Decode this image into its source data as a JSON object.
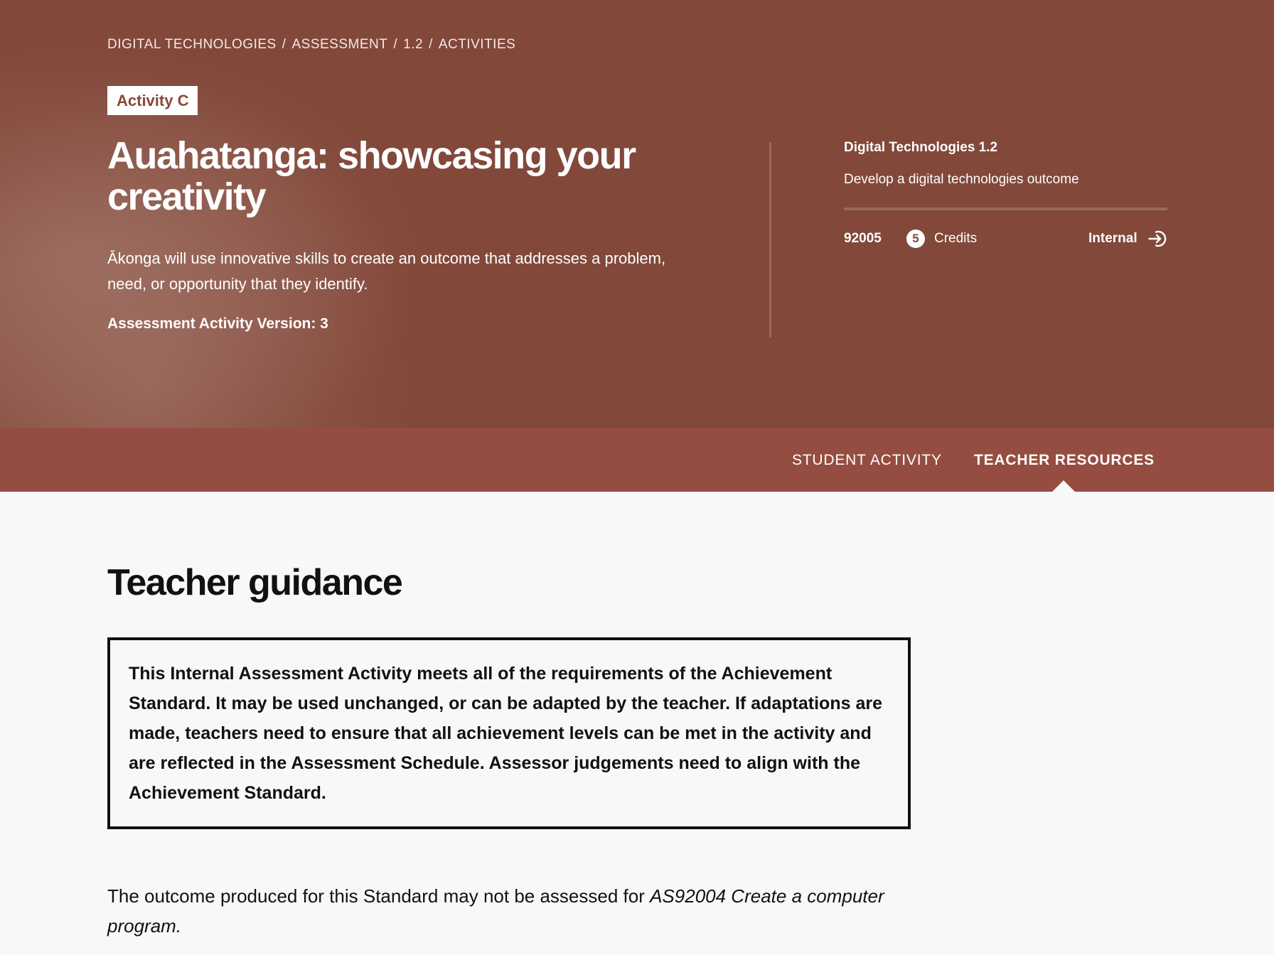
{
  "breadcrumb": {
    "items": [
      "DIGITAL TECHNOLOGIES",
      "ASSESSMENT",
      "1.2",
      "ACTIVITIES"
    ],
    "separator": "/"
  },
  "hero": {
    "badge": "Activity C",
    "title": "Auahatanga: showcasing your creativity",
    "description": "Ākonga will use innovative skills to create an outcome that addresses a problem, need, or opportunity that they identify.",
    "version": "Assessment Activity Version: 3"
  },
  "standard": {
    "title": "Digital Technologies 1.2",
    "description": "Develop a digital technologies outcome",
    "number": "92005",
    "credits": "5",
    "credits_label": "Credits",
    "assessment_type": "Internal",
    "assessment_icon": "internal-arrow-icon"
  },
  "tabs": [
    {
      "label": "STUDENT ACTIVITY",
      "active": false
    },
    {
      "label": "TEACHER RESOURCES",
      "active": true
    }
  ],
  "main": {
    "heading": "Teacher guidance",
    "notice": "This Internal Assessment Activity meets all of the requirements of the Achievement Standard. It may be used unchanged, or can be adapted by the teacher. If adaptations are made, teachers need to ensure that all achievement levels can be met in the activity and are reflected in the Assessment Schedule. Assessor judgements need to align with the Achievement Standard.",
    "outcome_text": "The outcome produced for this Standard may not be assessed for ",
    "outcome_italic": "AS92004 Create a computer program."
  },
  "colors": {
    "hero_bg": "#82483a",
    "tabbar_bg": "#964d41",
    "badge_text": "#8a4638",
    "page_bg": "#f8f8f8"
  }
}
